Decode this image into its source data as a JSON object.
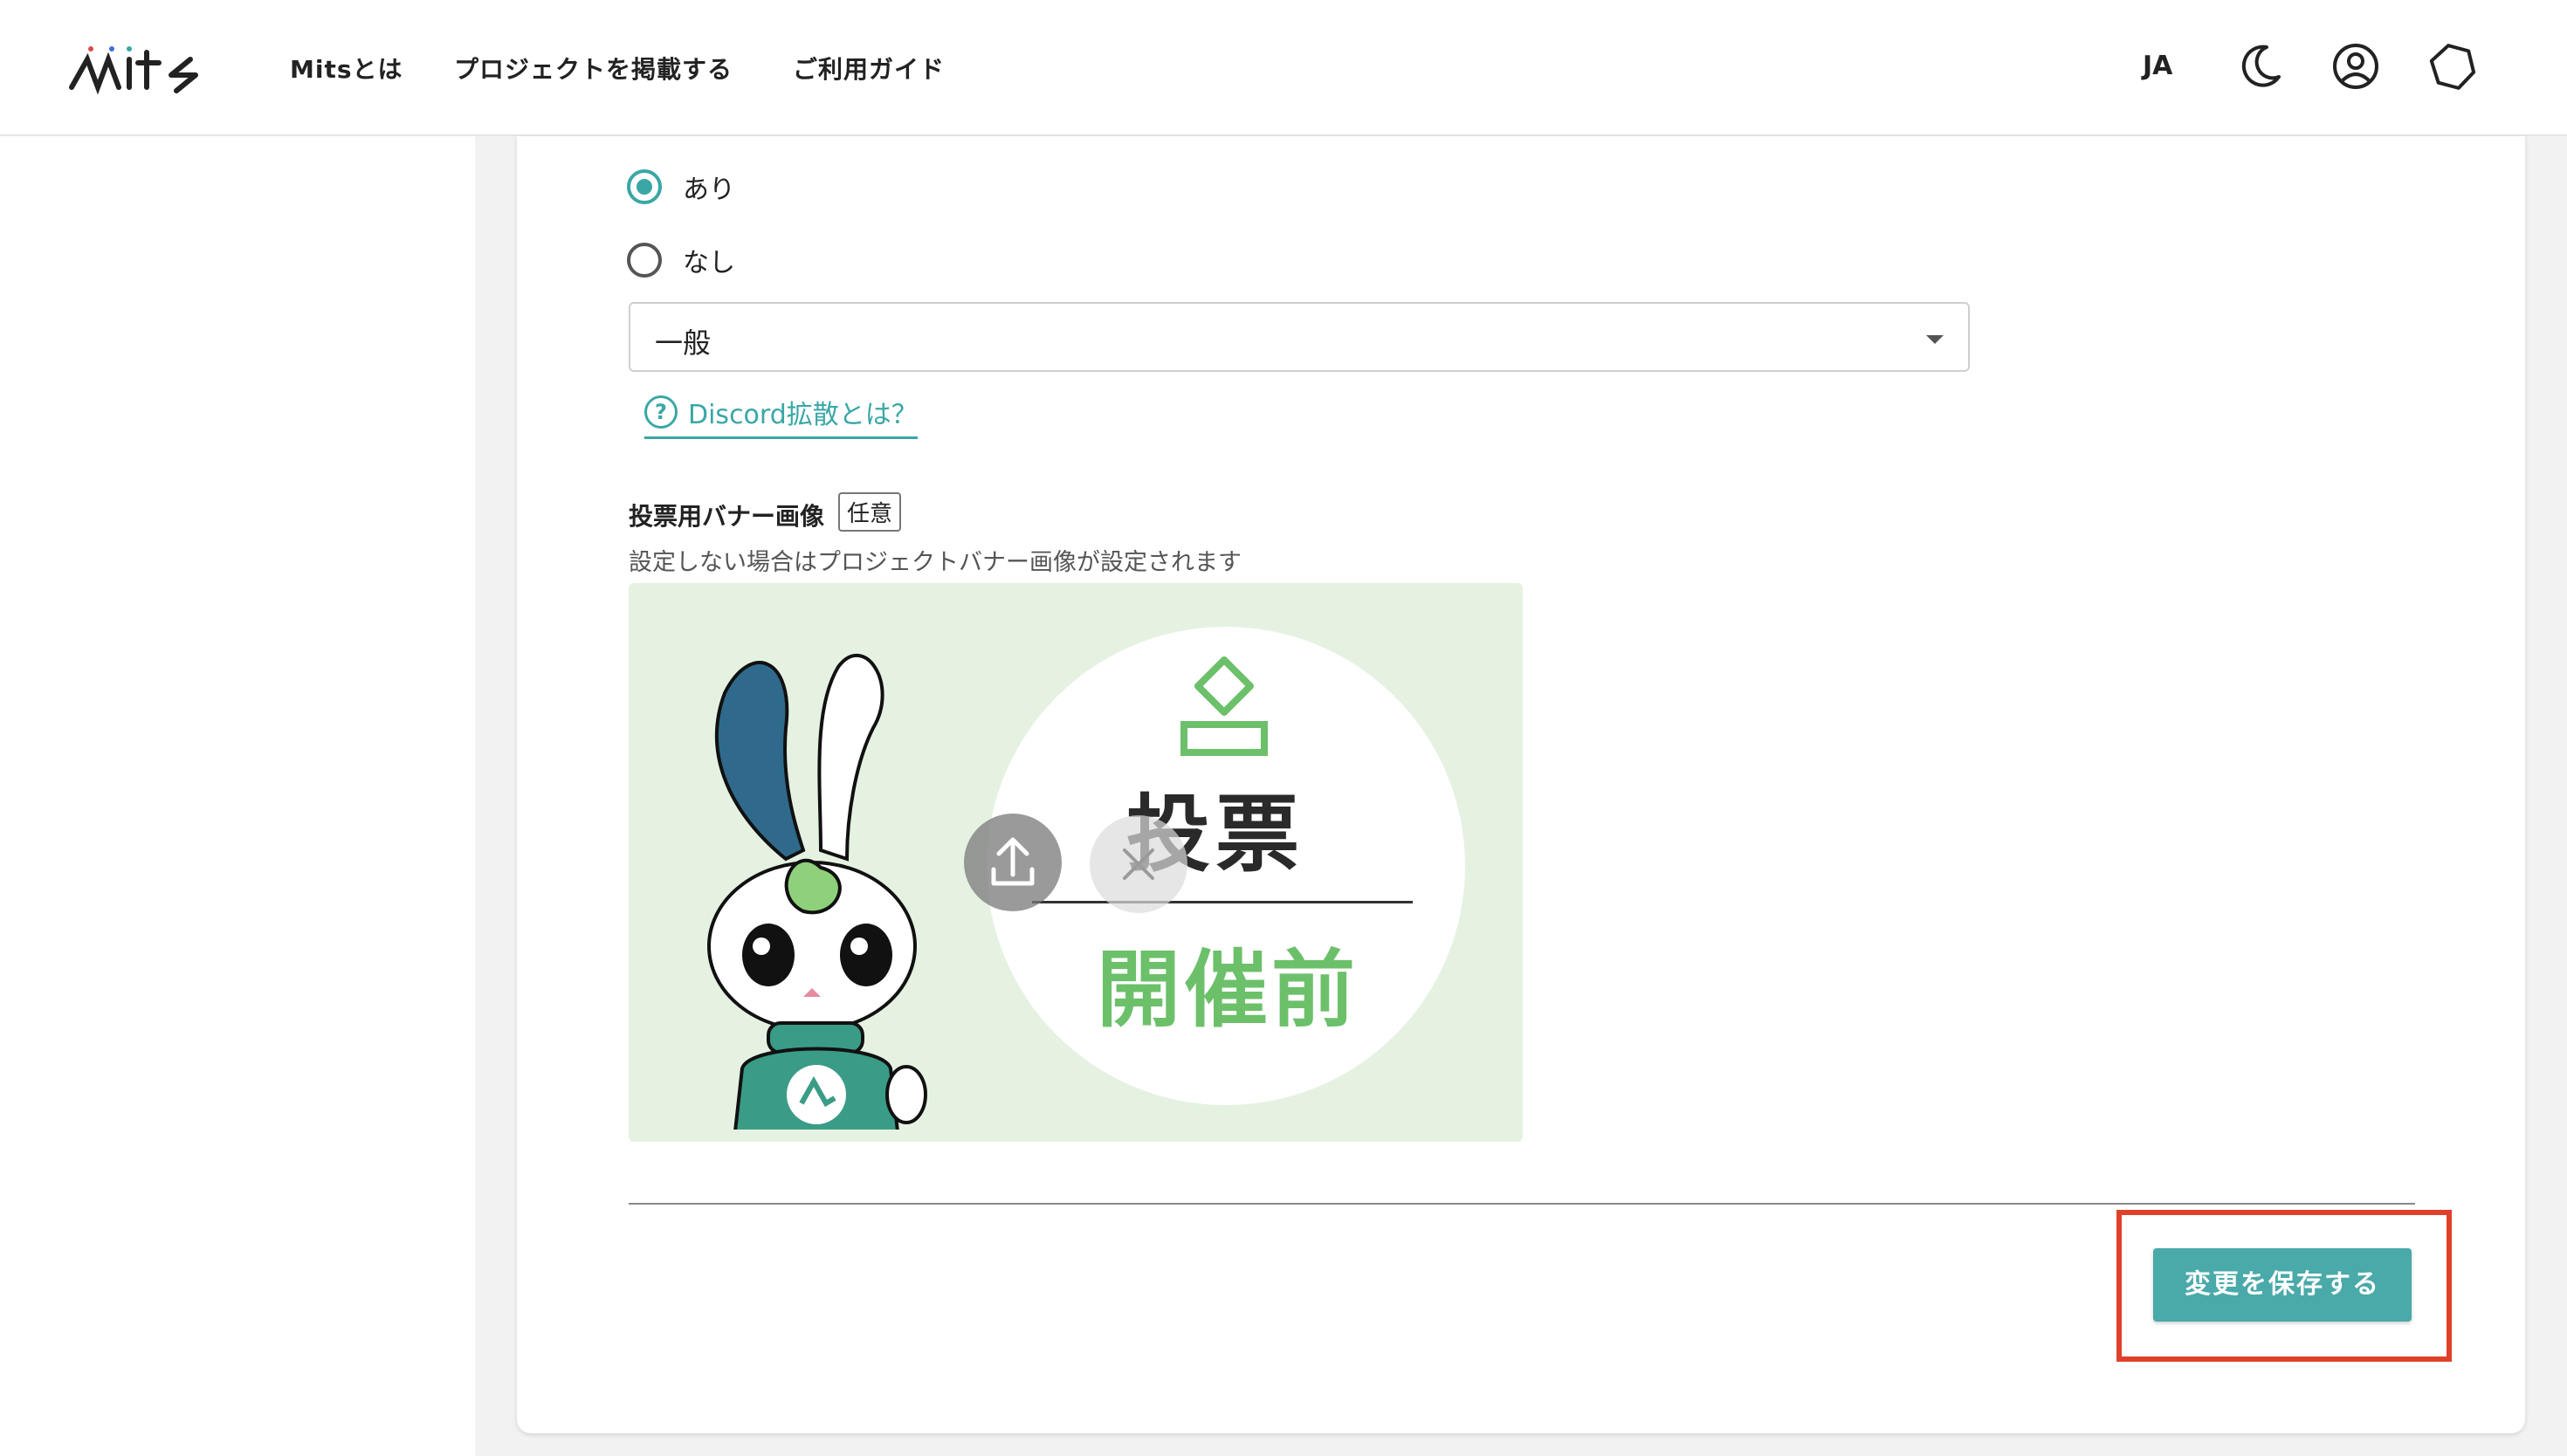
{
  "header": {
    "logo_text": "mits",
    "nav": [
      "Mitsとは",
      "プロジェクトを掲載する",
      "ご利用ガイド"
    ],
    "language": "JA",
    "icons": [
      "moon-icon",
      "user-icon",
      "hexagon-icon"
    ]
  },
  "form": {
    "discord_options": [
      {
        "label": "あり",
        "checked": true
      },
      {
        "label": "なし",
        "checked": false
      }
    ],
    "discord_category": "一般",
    "discord_help_link": "Discord拡散とは？",
    "banner_field": {
      "title": "投票用バナー画像",
      "badge": "任意",
      "description": "設定しない場合はプロジェクトバナー画像が設定されます"
    },
    "banner_image": {
      "vote_text": "投票",
      "status_text": "開催前"
    },
    "save_button": "変更を保存する"
  },
  "colors": {
    "accent": "#3aa7a6",
    "save": "#4aa9a9",
    "highlight": "#e0402a",
    "banner_bg": "#e5f2e2",
    "status_green": "#6cc06a"
  }
}
